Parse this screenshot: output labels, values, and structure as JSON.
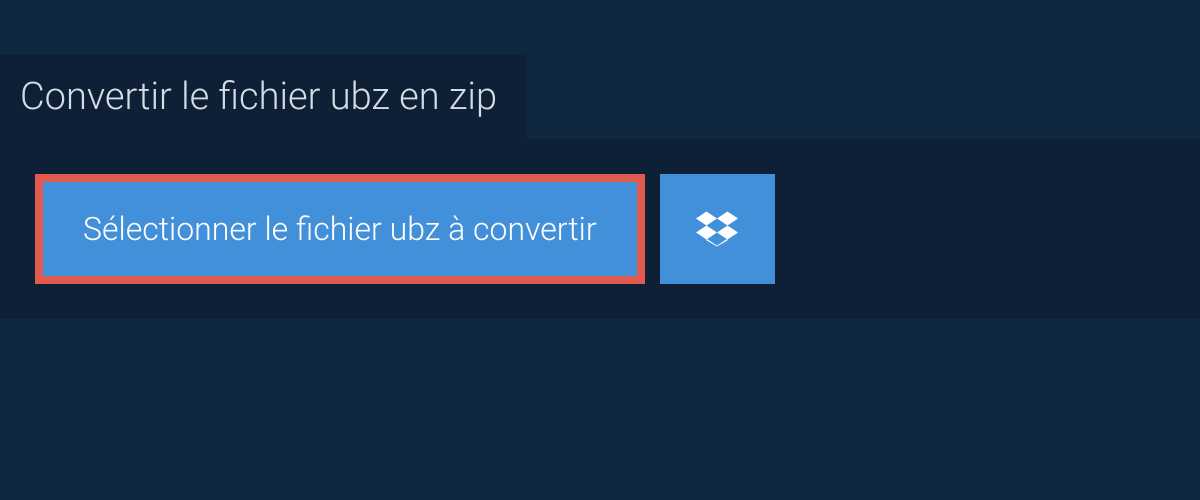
{
  "header": {
    "title": "Convertir le fichier ubz en zip"
  },
  "actions": {
    "select_file_label": "Sélectionner le fichier ubz à convertir"
  }
}
